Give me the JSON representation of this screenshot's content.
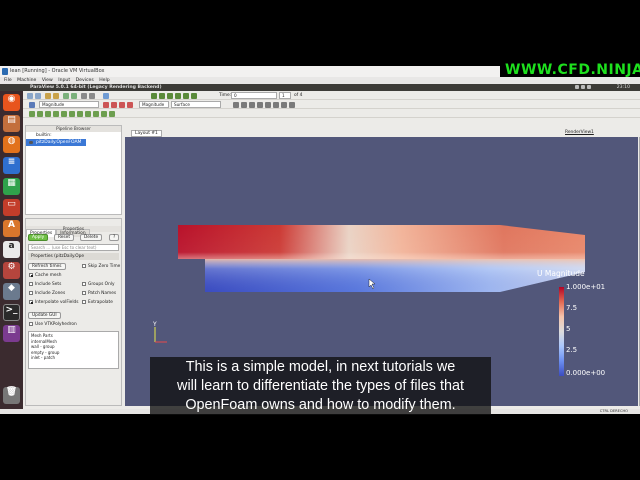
{
  "watermark": {
    "text": "WWW.CFD.NINJA",
    "color": "#1ee01e"
  },
  "vbox": {
    "title": "lean [Running] - Oracle VM VirtualBox",
    "menu": [
      "File",
      "Machine",
      "View",
      "Input",
      "Devices",
      "Help"
    ]
  },
  "ubuntu_panel": {
    "app_title": "ParaView 5.0.1 64-bit (Legacy Rendering Backend)",
    "clock": "23:10"
  },
  "launcher_icons": [
    "ubuntu-dash-icon",
    "files-icon",
    "firefox-icon",
    "libreoffice-writer-icon",
    "libreoffice-calc-icon",
    "libreoffice-impress-icon",
    "software-center-icon",
    "amazon-icon",
    "system-settings-icon",
    "paraview-icon",
    "terminal-icon",
    "workspace-icon",
    "trash-icon"
  ],
  "toolbar": {
    "time_label": "Time:",
    "time_value": "0",
    "frame_value": "1",
    "frame_of": "of 4",
    "color_by": "Magnitude",
    "representation": "Surface",
    "time_icon": "play-icon"
  },
  "pipeline": {
    "header": "Pipeline Browser",
    "items": [
      "builtin:",
      "pitzDaily.OpenFOAM"
    ]
  },
  "properties": {
    "tabs": [
      "Properties",
      "Information"
    ],
    "header": "Properties",
    "buttons": {
      "apply": "Apply",
      "reset": "Reset",
      "delete": "Delete",
      "help": "?"
    },
    "search_placeholder": "Search ... (use Esc to clear text)",
    "section_title": "Properties (pitzDaily.Ope",
    "refresh": "Refresh times",
    "skip_zero": "Skip Zero Time",
    "options": [
      {
        "label": "Cache mesh",
        "checked": true
      },
      {
        "label": "Groups Only",
        "checked": false
      },
      {
        "label": "Include Sets",
        "checked": false
      },
      {
        "label": "Patch Names",
        "checked": false
      },
      {
        "label": "Include Zones",
        "checked": false
      },
      {
        "label": "Interpolate volFields",
        "checked": true
      },
      {
        "label": "Extrapolate",
        "checked": false
      }
    ],
    "update_gui": "Update GUI",
    "polyhedron": "Use VTKPolyhedron",
    "mesh_parts_header": "Mesh Parts",
    "mesh_parts": [
      "internalMesh",
      "wall - group",
      "empty - group",
      "inlet - patch"
    ]
  },
  "view": {
    "layout_tab": "Layout #1",
    "render_label": "RenderView1",
    "axes_label": "Y"
  },
  "colorbar": {
    "title": "U Magnitude",
    "max": "1.000e+01",
    "t1": "7.5",
    "t2": "5",
    "t3": "2.5",
    "min": "0.000e+00"
  },
  "status": {
    "hostkey": "CTRL DERECHO"
  },
  "subtitle": {
    "line1": "This is a simple model, in next tutorials we",
    "line2": "will learn to differentiate the types of files that",
    "line3": "OpenFoam owns and how to modify them."
  }
}
